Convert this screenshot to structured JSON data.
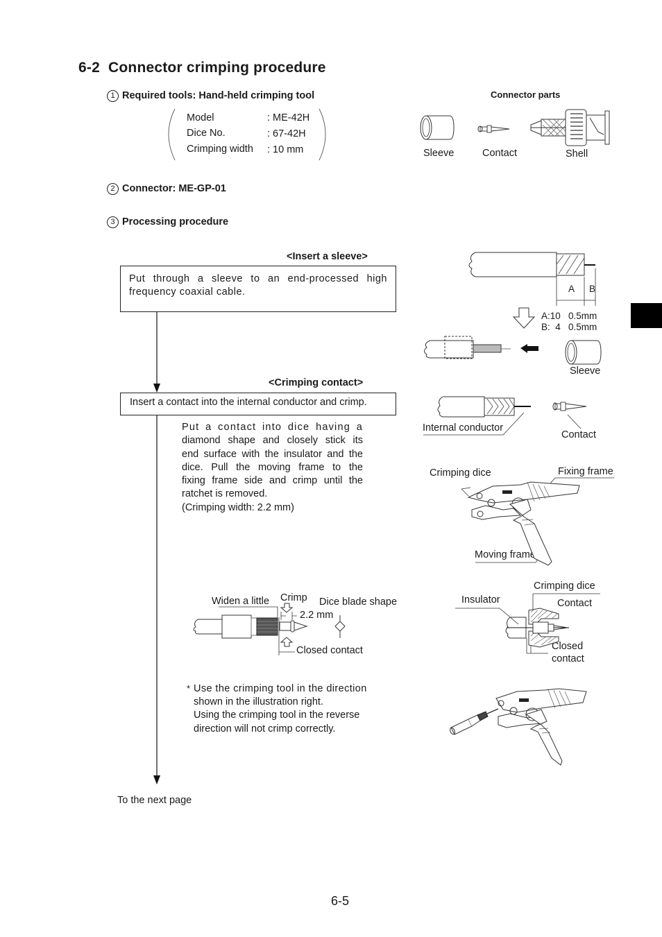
{
  "section": {
    "number": "6-2",
    "title": "Connector crimping procedure"
  },
  "items": [
    {
      "marker": "1",
      "label": "Required tools: Hand-held crimping tool"
    },
    {
      "marker": "2",
      "label": "Connector: ME-GP-01"
    },
    {
      "marker": "3",
      "label": "Processing procedure"
    }
  ],
  "tool_specs": [
    {
      "label": "Model",
      "value": ": ME-42H"
    },
    {
      "label": "Dice No.",
      "value": ": 67-42H"
    },
    {
      "label": "Crimping width",
      "value": ": 10 mm"
    }
  ],
  "connector_parts": {
    "title": "Connector parts",
    "parts": [
      "Sleeve",
      "Contact",
      "Shell"
    ]
  },
  "steps": [
    {
      "heading": "<Insert a sleeve>",
      "text": "Put through a sleeve to an end-processed high frequency coaxial cable."
    },
    {
      "heading": "<Crimping contact>",
      "text": "Insert a contact into the internal conductor and crimp.",
      "detail_lines": [
        "Put a contact into dice having a",
        "diamond shape and closely stick its",
        "end surface with the insulator and the",
        "dice. Pull the moving frame to the",
        "fixing frame side and crimp until the",
        "ratchet is removed.",
        "(Crimping width: 2.2 mm)"
      ]
    }
  ],
  "strip_diagram": {
    "dim_a_label": "A",
    "dim_b_label": "B",
    "tolerance_a": "A:10   0.5mm",
    "tolerance_b": "B:  4   0.5mm",
    "sleeve_label": "Sleeve"
  },
  "contact_diagram": {
    "internal_conductor_label": "Internal conductor",
    "contact_label": "Contact"
  },
  "tool_diagram": {
    "crimping_dice_label": "Crimping dice",
    "fixing_frame_label": "Fixing frame",
    "moving_frame_label": "Moving frame"
  },
  "crimp_detail": {
    "widen_label": "Widen a little",
    "crimp_label": "Crimp",
    "width_label": "2.2 mm",
    "blade_label": "Dice blade shape",
    "closed_label": "Closed contact"
  },
  "dice_section": {
    "crimping_dice_label": "Crimping dice",
    "insulator_label": "Insulator",
    "contact_label": "Contact",
    "closed_line1": "Closed",
    "closed_line2": "contact"
  },
  "note": {
    "marker": "*",
    "lines": [
      "Use the crimping tool in the direction",
      "shown in the illustration right.",
      "Using the crimping tool in the reverse",
      "direction will not crimp correctly."
    ]
  },
  "continuation": "To the next page",
  "page_number": "6-5"
}
